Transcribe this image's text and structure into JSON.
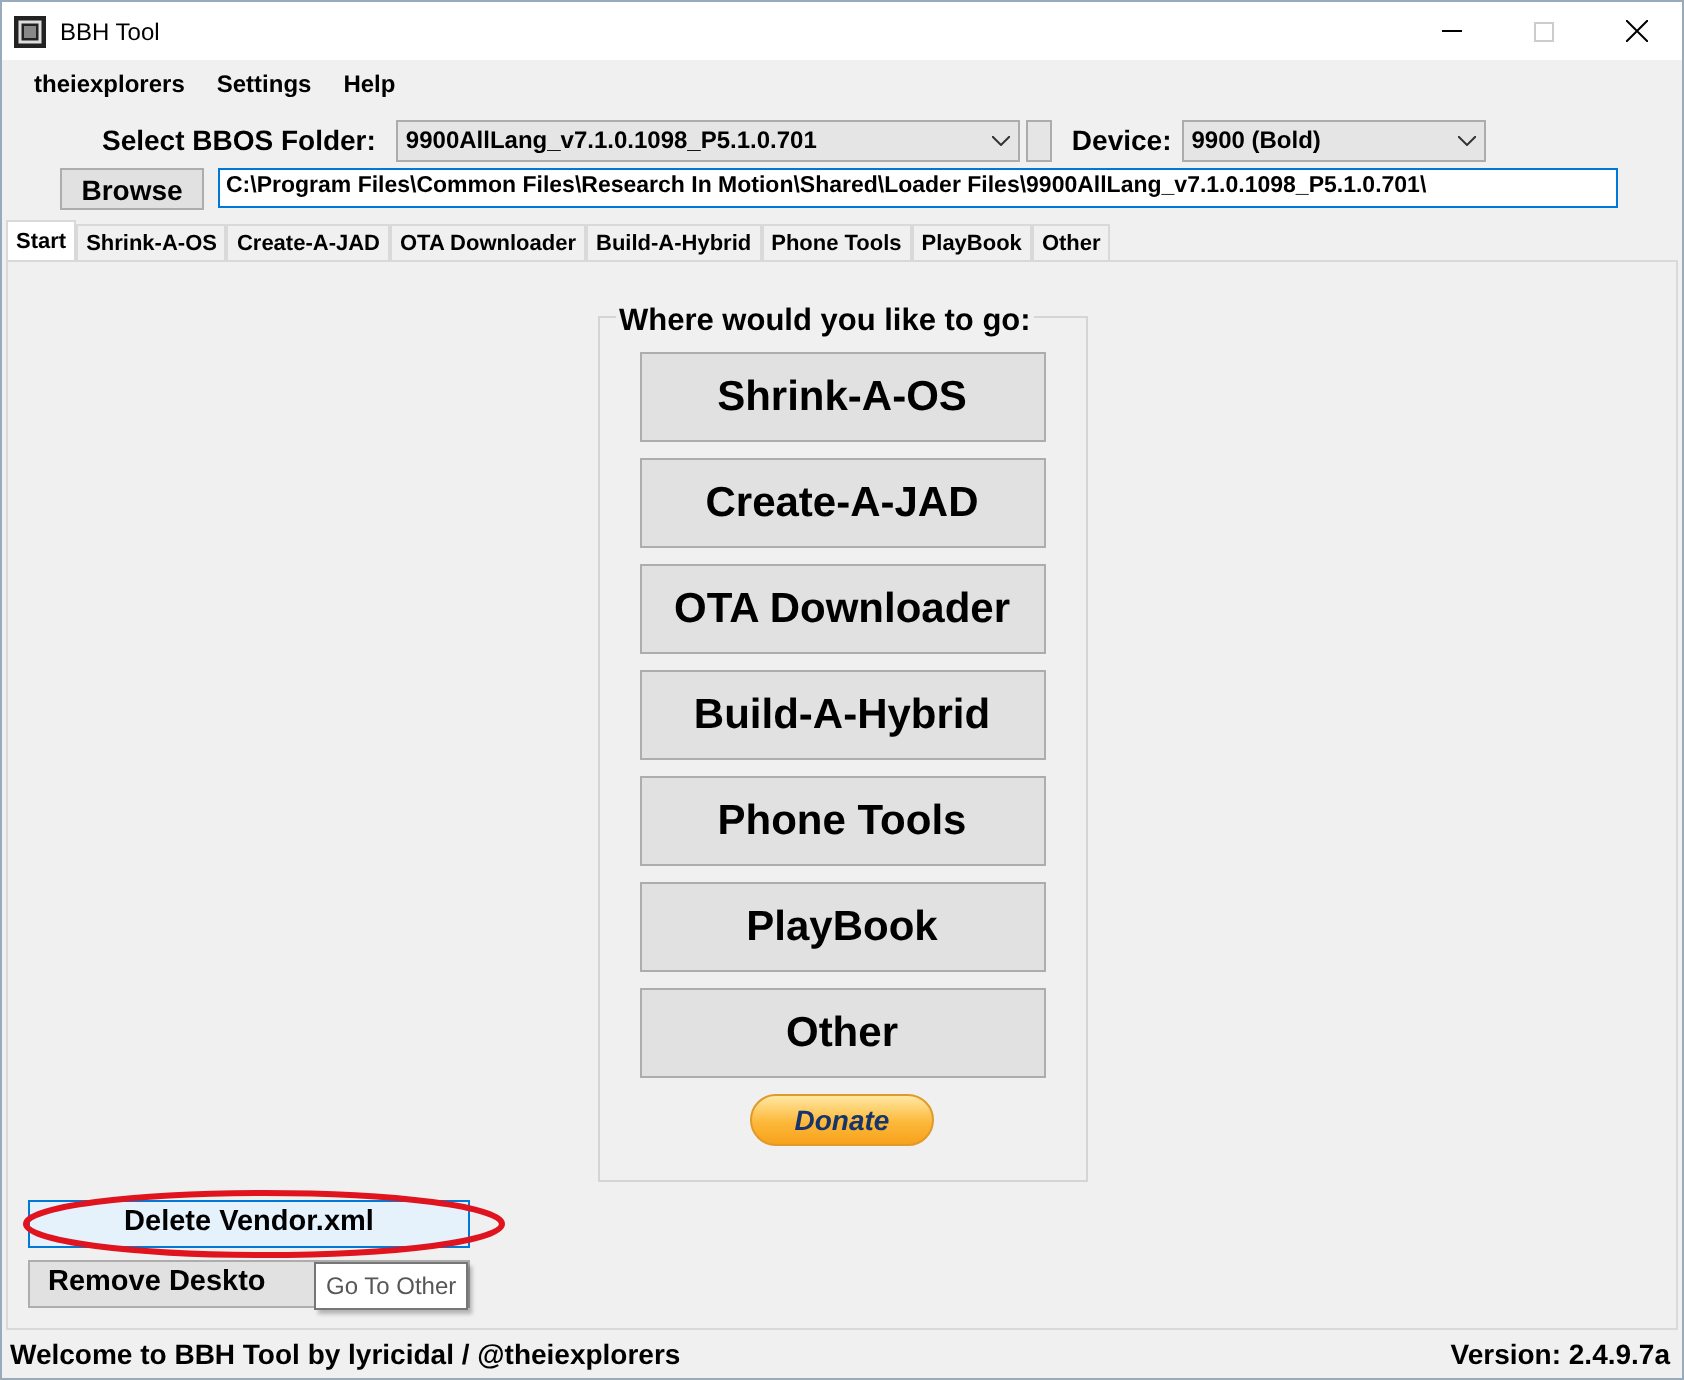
{
  "window": {
    "title": "BBH Tool"
  },
  "menu": [
    "theiexplorers",
    "Settings",
    "Help"
  ],
  "folder": {
    "label": "Select BBOS Folder:",
    "value": "9900AllLang_v7.1.0.1098_P5.1.0.701"
  },
  "device": {
    "label": "Device:",
    "value": "9900 (Bold)"
  },
  "browse": {
    "button": "Browse",
    "path": "C:\\Program Files\\Common Files\\Research In Motion\\Shared\\Loader Files\\9900AllLang_v7.1.0.1098_P5.1.0.701\\"
  },
  "tabs": [
    {
      "label": "Start",
      "selected": true
    },
    {
      "label": "Shrink-A-OS",
      "selected": false
    },
    {
      "label": "Create-A-JAD",
      "selected": false
    },
    {
      "label": "OTA Downloader",
      "selected": false
    },
    {
      "label": "Build-A-Hybrid",
      "selected": false
    },
    {
      "label": "Phone Tools",
      "selected": false
    },
    {
      "label": "PlayBook",
      "selected": false
    },
    {
      "label": "Other",
      "selected": false
    }
  ],
  "start": {
    "group_title": "Where would you like to go:",
    "buttons": [
      "Shrink-A-OS",
      "Create-A-JAD",
      "OTA Downloader",
      "Build-A-Hybrid",
      "Phone Tools",
      "PlayBook",
      "Other"
    ],
    "donate": "Donate"
  },
  "bottom_buttons": [
    {
      "label": "Delete Vendor.xml",
      "highlighted": true,
      "circled": true
    },
    {
      "label": "Remove Deskto",
      "highlighted": false,
      "circled": false
    }
  ],
  "tooltip": "Go To Other",
  "status_bar": {
    "left": "Welcome to BBH Tool by lyricidal / @theiexplorers",
    "right": "Version: 2.4.9.7a"
  }
}
